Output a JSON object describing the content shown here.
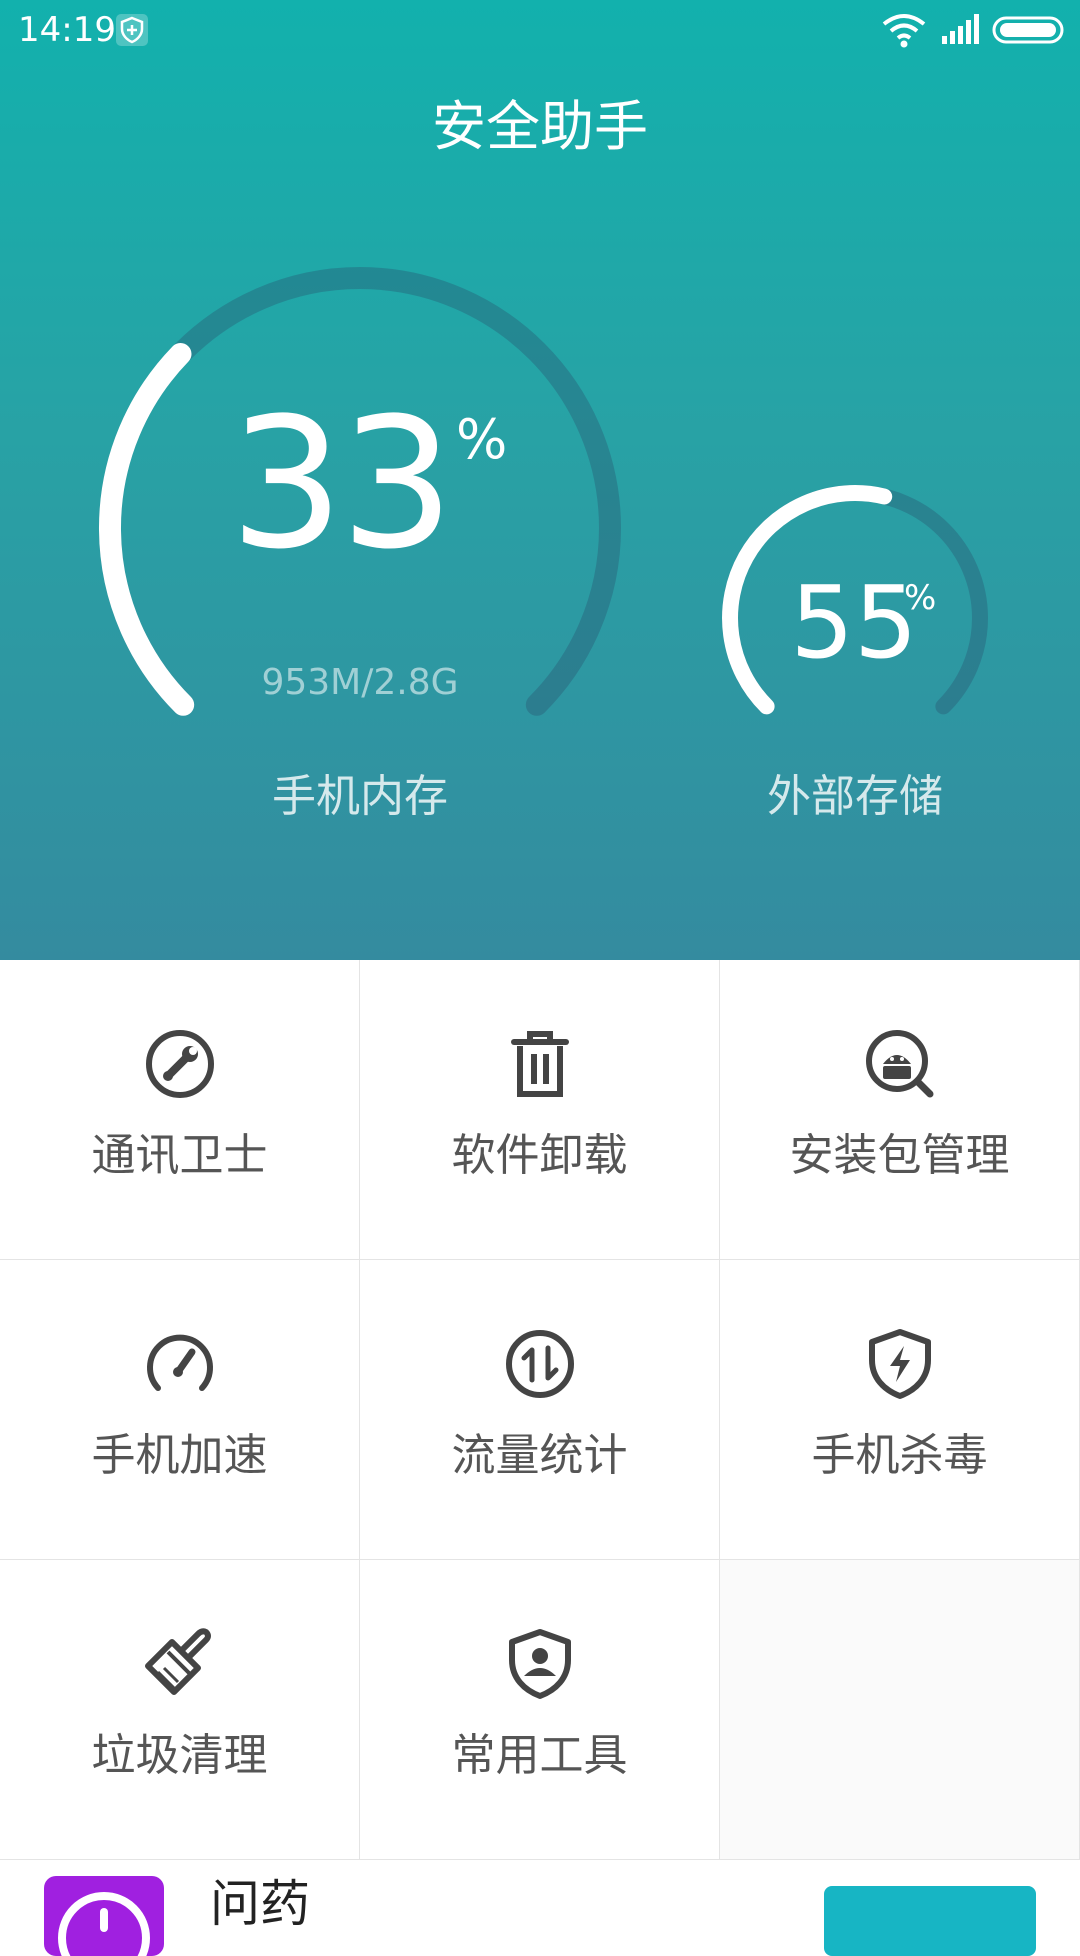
{
  "statusbar": {
    "time": "14:19"
  },
  "header": {
    "title": "安全助手"
  },
  "memory": {
    "percent": "33",
    "percent_value": 33,
    "unit": "%",
    "detail": "953M/2.8G",
    "label": "手机内存"
  },
  "storage": {
    "percent": "55",
    "percent_value": 55,
    "unit": "%",
    "label": "外部存储"
  },
  "tools": [
    {
      "label": "通讯卫士",
      "icon": "wrench-icon"
    },
    {
      "label": "软件卸载",
      "icon": "trash-icon"
    },
    {
      "label": "安装包管理",
      "icon": "android-search-icon"
    },
    {
      "label": "手机加速",
      "icon": "speedometer-icon"
    },
    {
      "label": "流量统计",
      "icon": "data-traffic-icon"
    },
    {
      "label": "手机杀毒",
      "icon": "shield-bolt-icon"
    },
    {
      "label": "垃圾清理",
      "icon": "broom-icon"
    },
    {
      "label": "常用工具",
      "icon": "shield-user-icon"
    }
  ],
  "ad": {
    "title": "问药"
  },
  "colors": {
    "hero_top": "#12b1ad",
    "hero_bottom": "#348b9f",
    "ad_button": "#17b5c4"
  }
}
